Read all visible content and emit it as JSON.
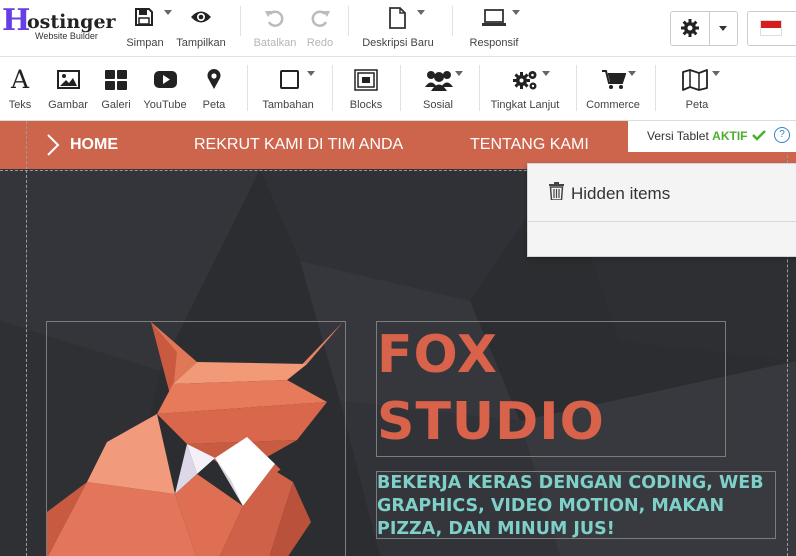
{
  "logo": {
    "initial": "H",
    "rest": "ostinger",
    "subtitle": "Website Builder",
    "color": "#673de6"
  },
  "topbar": {
    "simpan": {
      "label": "Simpan",
      "icon": "save-icon"
    },
    "tampilkan": {
      "label": "Tampilkan",
      "icon": "eye-icon"
    },
    "batalkan": {
      "label": "Batalkan",
      "icon": "undo-icon",
      "disabled": true
    },
    "redo": {
      "label": "Redo",
      "icon": "redo-icon",
      "disabled": true
    },
    "deskripsi": {
      "label": "Deskripsi Baru",
      "icon": "document-icon"
    },
    "responsif": {
      "label": "Responsif",
      "icon": "laptop-icon"
    },
    "settings_icon": "gear-icon",
    "language_icon": "flag-indonesia-icon"
  },
  "toolbar": {
    "items": [
      {
        "label": "Teks",
        "icon": "text-icon"
      },
      {
        "label": "Gambar",
        "icon": "image-icon"
      },
      {
        "label": "Galeri",
        "icon": "gallery-icon"
      },
      {
        "label": "YouTube",
        "icon": "youtube-icon"
      },
      {
        "label": "Peta",
        "icon": "map-pin-icon"
      },
      {
        "label": "Tambahan",
        "icon": "square-icon"
      },
      {
        "label": "Blocks",
        "icon": "blocks-icon"
      },
      {
        "label": "Sosial",
        "icon": "people-icon"
      },
      {
        "label": "Tingkat Lanjut",
        "icon": "cogs-icon"
      },
      {
        "label": "Commerce",
        "icon": "cart-icon"
      },
      {
        "label": "Peta",
        "icon": "map-icon"
      }
    ]
  },
  "site": {
    "nav": [
      "HOME",
      "REKRUT KAMI DI TIM ANDA",
      "TENTANG KAMI"
    ],
    "title_line1": "FOX",
    "title_line2": "STUDIO",
    "subtitle_lines": [
      "BEKERJA KERAS DENGAN CODING, WEB",
      "GRAPHICS, VIDEO MOTION, MAKAN",
      "PIZZA, DAN MINUM JUS!"
    ],
    "accent_color": "#cd654d",
    "title_color": "#d9624a",
    "subtitle_color": "#7fd0c9"
  },
  "versi": {
    "label": "Versi Tablet",
    "status": "AKTIF",
    "help": "?"
  },
  "hidden_items": {
    "label": "Hidden items",
    "icon": "trash-icon"
  }
}
